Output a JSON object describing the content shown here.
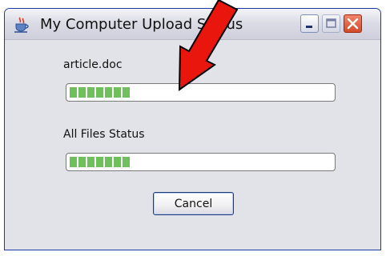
{
  "window": {
    "title": "My Computer Upload Status"
  },
  "titlebar_buttons": {
    "minimize_icon": "minimize-icon",
    "maximize_icon": "maximize-icon",
    "close_icon": "close-icon"
  },
  "file_upload": {
    "label": "article.doc",
    "progress_fraction": 0.23
  },
  "all_files": {
    "label": "All Files Status",
    "progress_fraction": 0.23
  },
  "actions": {
    "cancel_label": "Cancel"
  },
  "colors": {
    "progress_fill": "#6fbf5c",
    "annotation_arrow": "#e8160c",
    "titlebar_close": "#d24c2b"
  },
  "annotation": {
    "icon": "red-arrow-icon"
  }
}
